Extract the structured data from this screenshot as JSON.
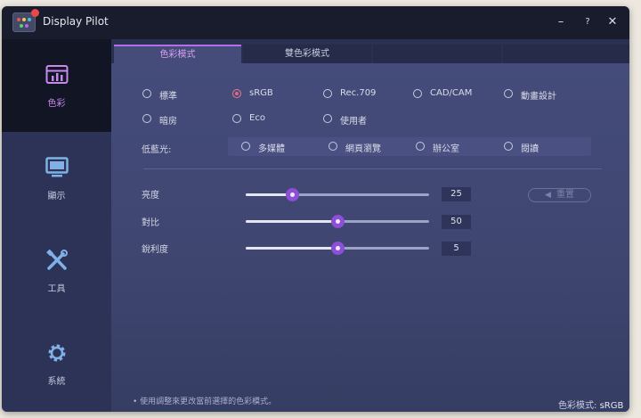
{
  "window": {
    "title": "Display Pilot"
  },
  "controls": {
    "minimize": "–",
    "help": "?",
    "close": "✕"
  },
  "sidebar": {
    "items": [
      {
        "label": "色彩",
        "icon": "color-chart-icon",
        "active": true
      },
      {
        "label": "顯示",
        "icon": "monitor-icon",
        "active": false
      },
      {
        "label": "工具",
        "icon": "tools-icon",
        "active": false
      },
      {
        "label": "系統",
        "icon": "gear-icon",
        "active": false
      }
    ]
  },
  "tabs": [
    {
      "label": "色彩模式",
      "active": true
    },
    {
      "label": "雙色彩模式",
      "active": false
    }
  ],
  "color_modes": {
    "selected": "sRGB",
    "options": [
      "標準",
      "sRGB",
      "Rec.709",
      "CAD/CAM",
      "動畫設計",
      "暗房",
      "Eco",
      "使用者"
    ]
  },
  "low_blue": {
    "label": "低藍光:",
    "options": [
      "多媒體",
      "網頁瀏覽",
      "辦公室",
      "閱讀"
    ]
  },
  "sliders": [
    {
      "label": "亮度",
      "value": "25",
      "fraction": 0.25
    },
    {
      "label": "對比",
      "value": "50",
      "fraction": 0.5
    },
    {
      "label": "銳利度",
      "value": "5",
      "fraction": 0.5
    }
  ],
  "reset_label": "重置",
  "footer": {
    "hint": "•  使用調整來更改當前選擇的色彩模式。",
    "status_label": "色彩模式:",
    "status_value": "sRGB"
  },
  "colors": {
    "accent": "#b56de8",
    "thumb": "#8c4fd6",
    "selected_radio": "#f06080"
  }
}
